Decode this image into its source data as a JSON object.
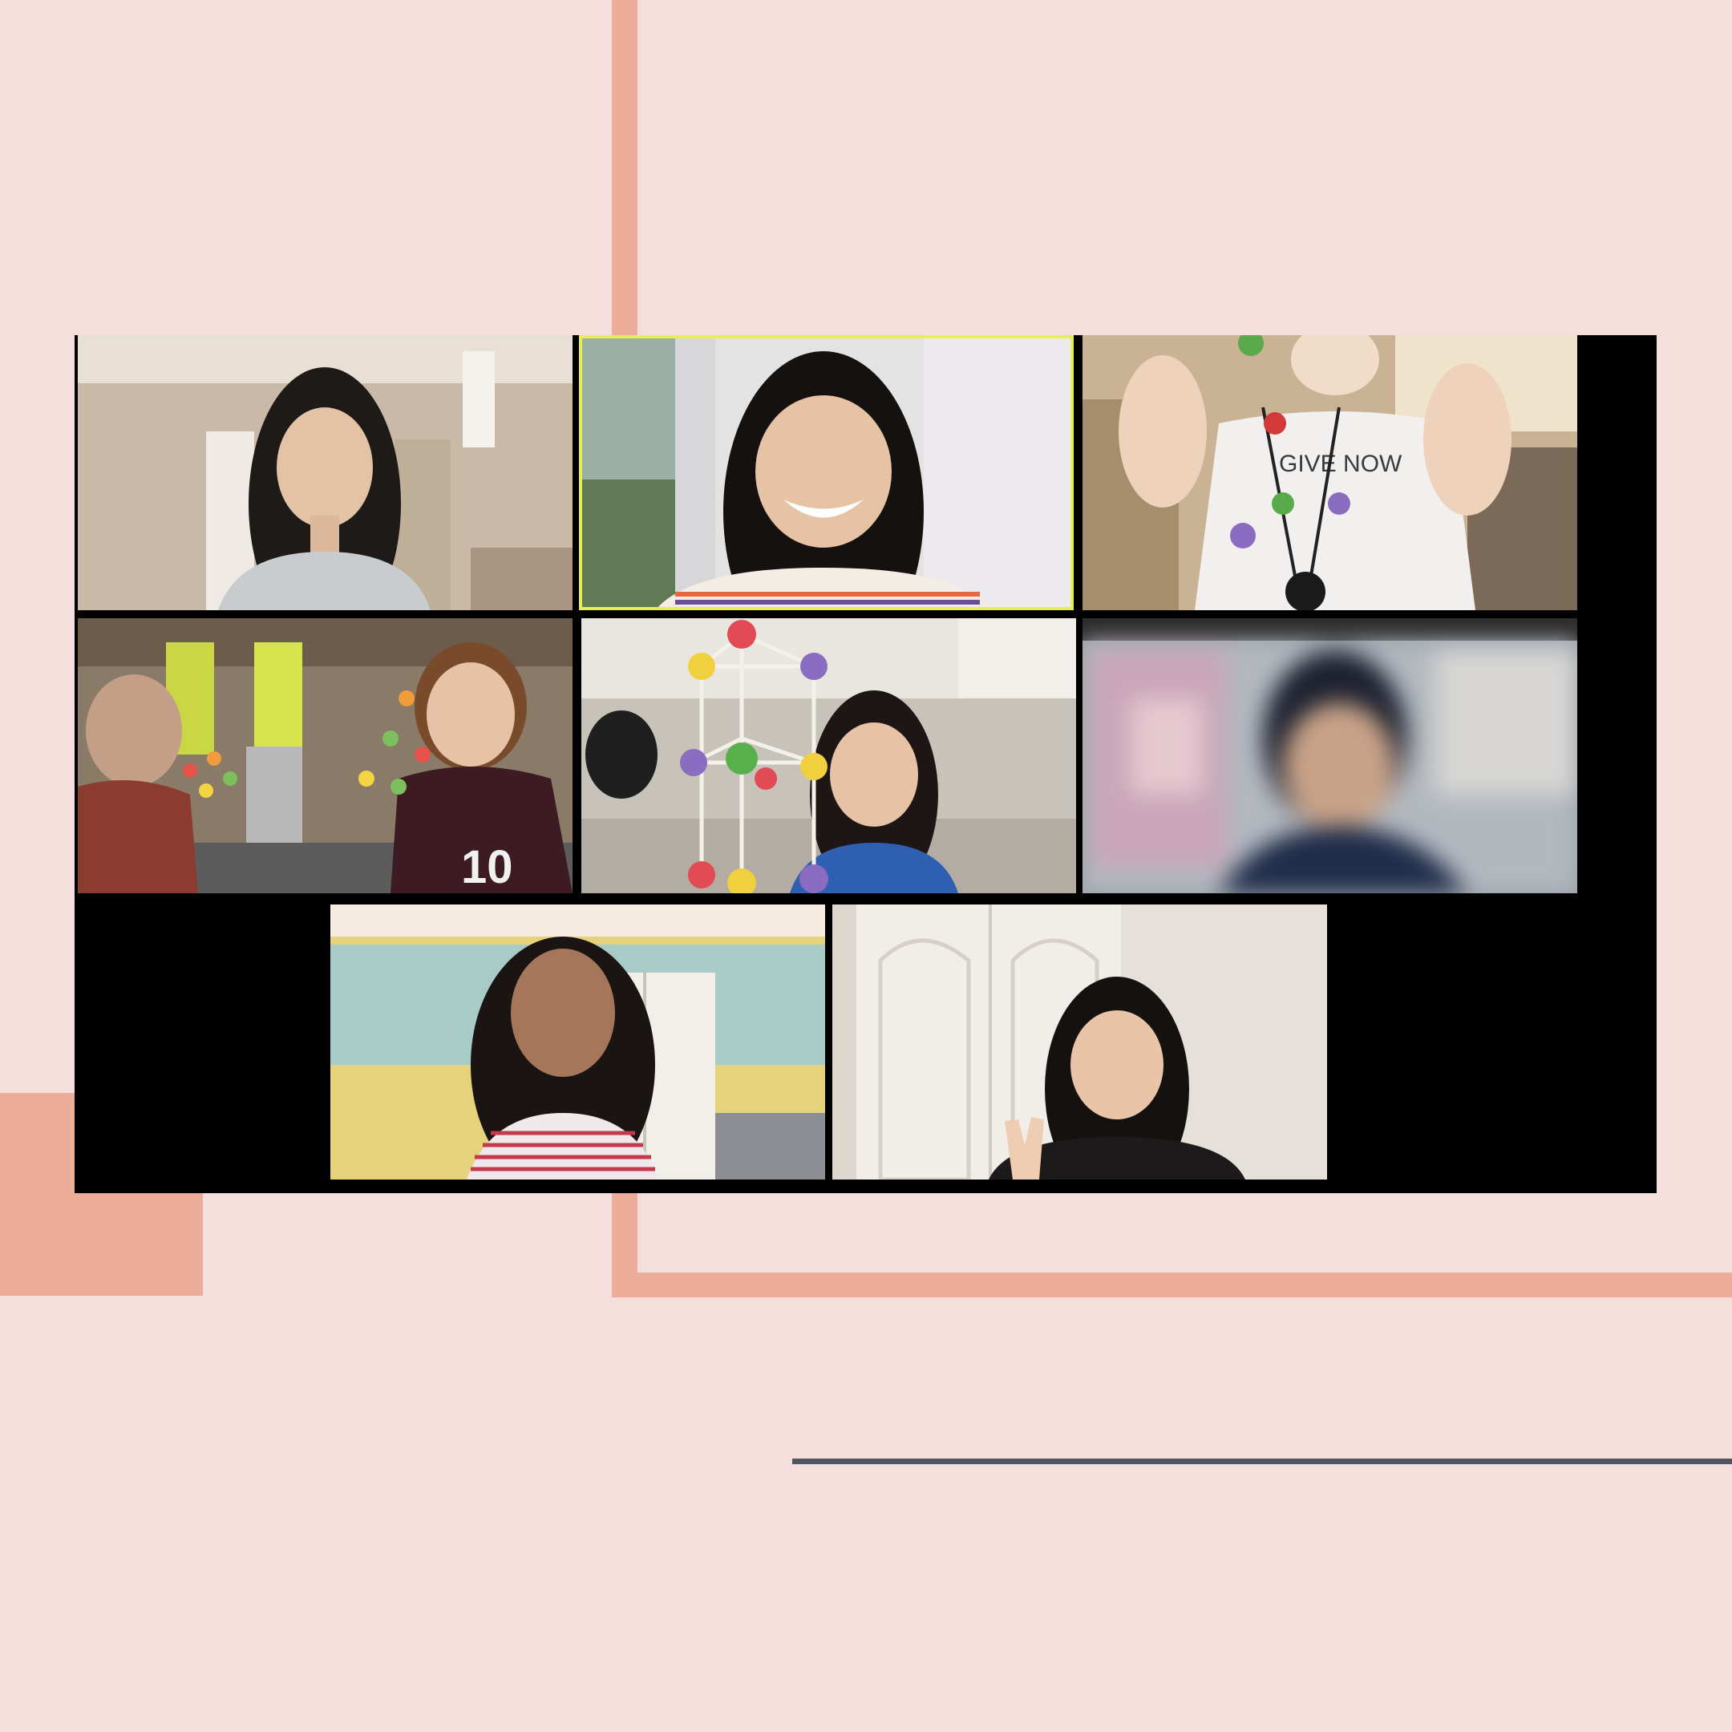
{
  "app": {
    "view": "gallery",
    "accent_color": "#ecad9b",
    "background_color": "#f5dfdd",
    "active_speaker_border": "#e6ee55"
  },
  "participants": [
    {
      "tile": 1,
      "active_speaker": false,
      "video": "on"
    },
    {
      "tile": 2,
      "active_speaker": true,
      "video": "on"
    },
    {
      "tile": 3,
      "active_speaker": false,
      "video": "on",
      "shirt_text": "GIVE NOW"
    },
    {
      "tile": 4,
      "active_speaker": false,
      "video": "on",
      "jersey_number": "10"
    },
    {
      "tile": 5,
      "active_speaker": false,
      "video": "on"
    },
    {
      "tile": 6,
      "active_speaker": false,
      "video": "blurred"
    },
    {
      "tile": 7,
      "active_speaker": false,
      "video": "on"
    },
    {
      "tile": 8,
      "active_speaker": false,
      "video": "on"
    }
  ]
}
